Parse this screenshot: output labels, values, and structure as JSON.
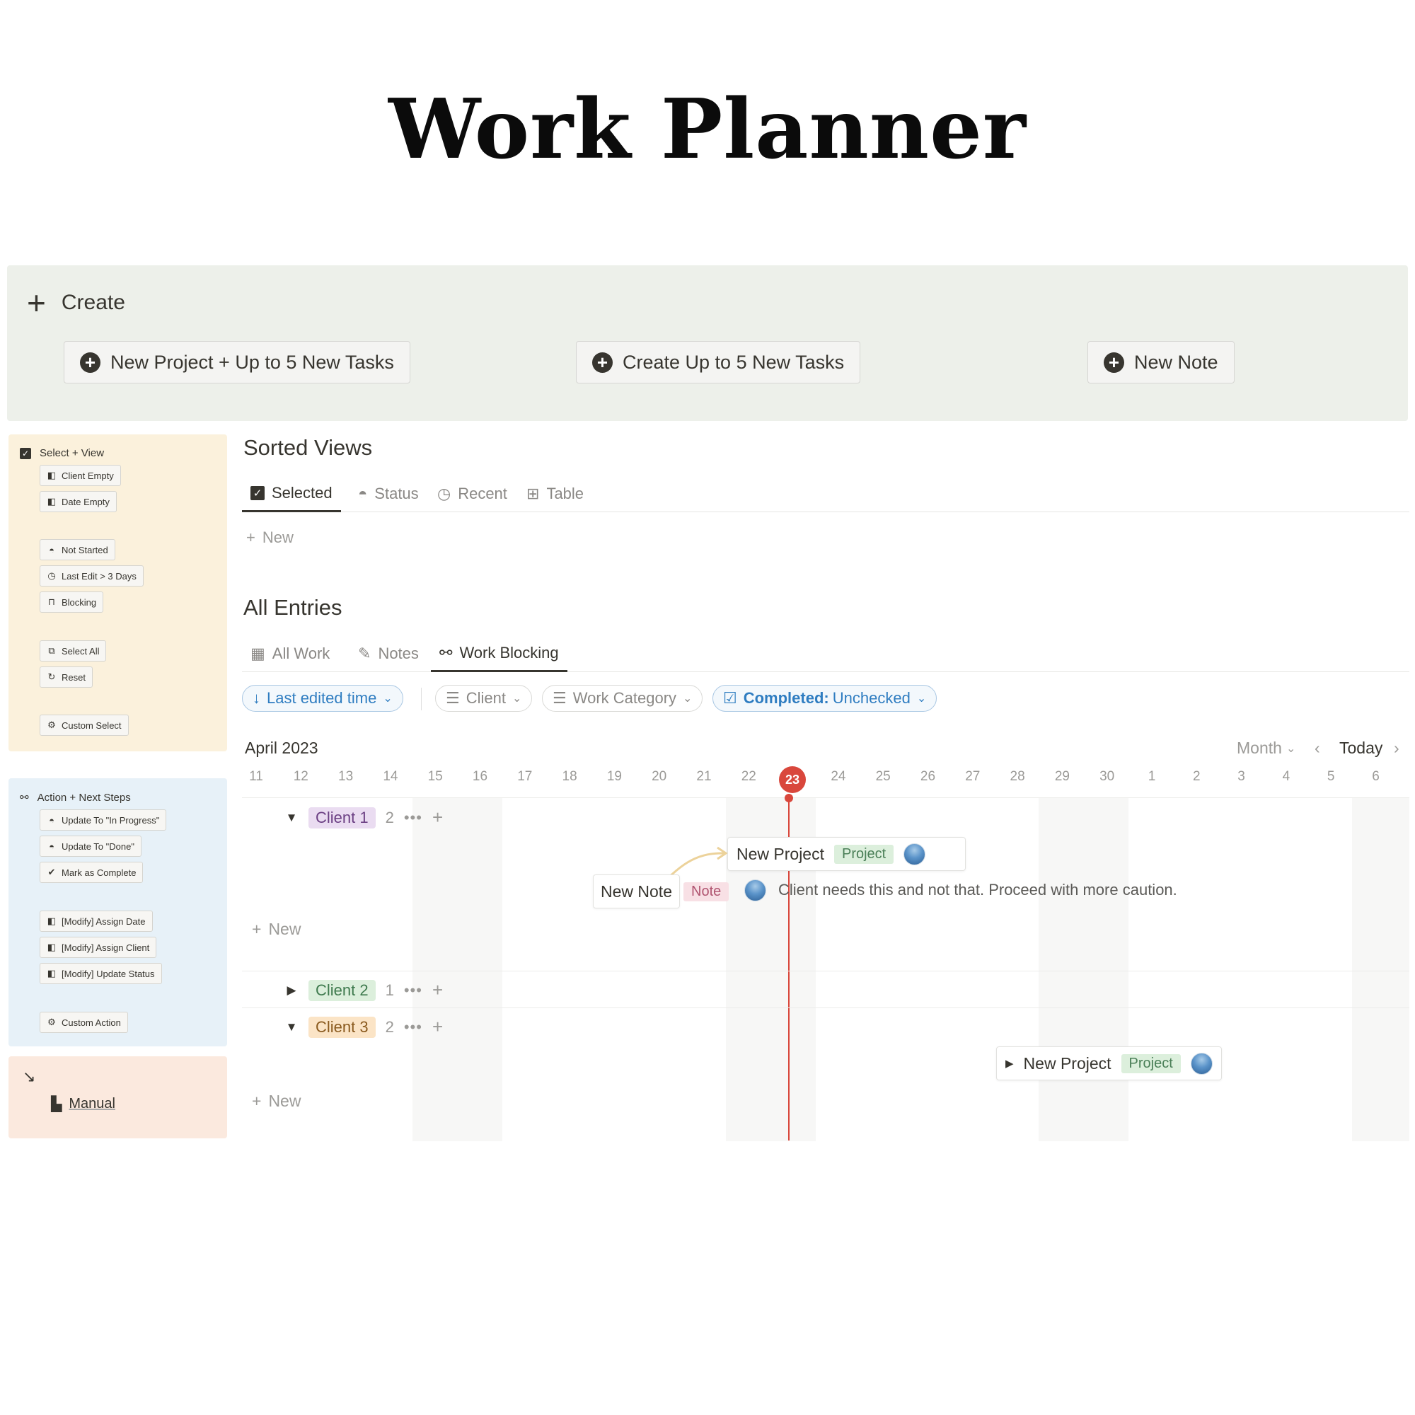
{
  "page_title": "Work Planner",
  "create": {
    "heading": "Create",
    "buttons": [
      "New Project + Up to 5 New Tasks",
      "Create Up to 5 New Tasks",
      "New Note"
    ]
  },
  "select_panel": {
    "heading": "Select + View",
    "buttons": [
      "Client Empty",
      "Date Empty",
      "Not Started",
      "Last Edit > 3 Days",
      "Blocking",
      "Select All",
      "Reset",
      "Custom Select"
    ]
  },
  "action_panel": {
    "heading": "Action + Next Steps",
    "buttons": [
      "Update To \"In Progress\"",
      "Update To \"Done\"",
      "Mark as Complete",
      "[Modify] Assign Date",
      "[Modify] Assign Client",
      "[Modify] Update Status",
      "Custom Action"
    ]
  },
  "manual_panel": {
    "label": "Manual"
  },
  "sorted_views": {
    "title": "Sorted Views",
    "tabs": [
      "Selected",
      "Status",
      "Recent",
      "Table"
    ],
    "new_label": "New"
  },
  "all_entries": {
    "title": "All Entries",
    "tabs": [
      "All Work",
      "Notes",
      "Work Blocking"
    ],
    "filters": {
      "sort": "Last edited time",
      "client": "Client",
      "work_category": "Work Category",
      "completed_key": "Completed:",
      "completed_value": "Unchecked"
    }
  },
  "calendar": {
    "month_label": "April 2023",
    "view": "Month",
    "today_label": "Today",
    "days": [
      "11",
      "12",
      "13",
      "14",
      "15",
      "16",
      "17",
      "18",
      "19",
      "20",
      "21",
      "22",
      "23",
      "24",
      "25",
      "26",
      "27",
      "28",
      "29",
      "30",
      "1",
      "2",
      "3",
      "4",
      "5",
      "6"
    ],
    "today": "23",
    "groups": [
      {
        "name": "Client 1",
        "count": "2",
        "expanded": true
      },
      {
        "name": "Client 2",
        "count": "1",
        "expanded": false
      },
      {
        "name": "Client 3",
        "count": "2",
        "expanded": true
      }
    ],
    "new_label": "New",
    "items": {
      "client1_project": {
        "title": "New Project",
        "tag": "Project"
      },
      "client1_note": {
        "title": "New Note",
        "tag": "Note",
        "text": "Client needs this and not that. Proceed with more caution."
      },
      "client3_project": {
        "title": "New Project",
        "tag": "Project"
      }
    }
  },
  "colors": {
    "create_bg": "#edf0ea",
    "select_bg": "#fbf1dc",
    "action_bg": "#e7f1f8",
    "manual_bg": "#fbe9de",
    "today_red": "#d9473c",
    "client1_tag": "#eadcf1",
    "client2_tag": "#dcefdc",
    "client3_tag": "#fbe4c6"
  }
}
